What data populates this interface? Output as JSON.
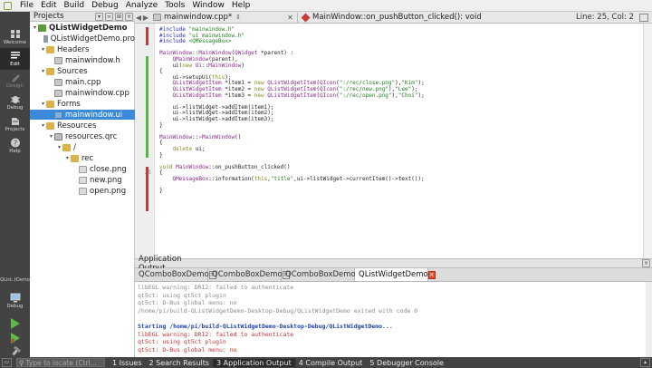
{
  "menu": [
    "File",
    "Edit",
    "Build",
    "Debug",
    "Analyze",
    "Tools",
    "Window",
    "Help"
  ],
  "modes": [
    {
      "label": "Welcome",
      "state": "normal"
    },
    {
      "label": "Edit",
      "state": "active"
    },
    {
      "label": "Design",
      "state": "disabled"
    },
    {
      "label": "Debug",
      "state": "normal"
    },
    {
      "label": "Projects",
      "state": "normal"
    },
    {
      "label": "Help",
      "state": "normal"
    }
  ],
  "kit": {
    "project_label": "QList..tDemo",
    "config_label": "Debug"
  },
  "project_pane": {
    "title": "Projects"
  },
  "tree": [
    {
      "label": "QListWidgetDemo",
      "level": 0,
      "expanded": true,
      "icon": "project-icon",
      "bold": true
    },
    {
      "label": "QListWidgetDemo.pro",
      "level": 1,
      "icon": "pro-file-icon"
    },
    {
      "label": "Headers",
      "level": 1,
      "expanded": true,
      "icon": "folder-icon"
    },
    {
      "label": "mainwindow.h",
      "level": 2,
      "icon": "header-file-icon"
    },
    {
      "label": "Sources",
      "level": 1,
      "expanded": true,
      "icon": "folder-icon"
    },
    {
      "label": "main.cpp",
      "level": 2,
      "icon": "source-file-icon"
    },
    {
      "label": "mainwindow.cpp",
      "level": 2,
      "icon": "source-file-icon"
    },
    {
      "label": "Forms",
      "level": 1,
      "expanded": true,
      "icon": "folder-icon"
    },
    {
      "label": "mainwindow.ui",
      "level": 2,
      "icon": "ui-file-icon",
      "selected": true
    },
    {
      "label": "Resources",
      "level": 1,
      "expanded": true,
      "icon": "folder-icon"
    },
    {
      "label": "resources.qrc",
      "level": 2,
      "expanded": true,
      "icon": "qrc-file-icon"
    },
    {
      "label": "/",
      "level": 3,
      "expanded": true,
      "icon": "folder-icon"
    },
    {
      "label": "rec",
      "level": 4,
      "expanded": true,
      "icon": "folder-icon"
    },
    {
      "label": "close.png",
      "level": 5,
      "icon": "png-file-icon"
    },
    {
      "label": "new.png",
      "level": 5,
      "icon": "png-file-icon"
    },
    {
      "label": "open.png",
      "level": 5,
      "icon": "png-file-icon"
    }
  ],
  "editor": {
    "file_tab": "mainwindow.cpp*",
    "function": "MainWindow::on_pushButton_clicked(): void",
    "position": "Line: 25, Col: 2"
  },
  "code_lines": [
    {
      "n": "",
      "html": "<span class='k-pre'>#include</span> <span class='k-str'>\"mainwindow.h\"</span>"
    },
    {
      "n": "",
      "html": "<span class='k-pre'>#include</span> <span class='k-str'>\"ui_mainwindow.h\"</span>"
    },
    {
      "n": "",
      "html": "<span class='k-pre'>#include</span> <span class='k-str'>&lt;QMessageBox&gt;</span>"
    },
    {
      "n": "",
      "html": ""
    },
    {
      "n": "",
      "html": "<span class='k-type'>MainWindow</span>::<span class='k-type'>MainWindow</span>(<span class='k-type'>QWidget</span> *parent) :"
    },
    {
      "n": "",
      "html": "    <span class='k-type'>QMainWindow</span>(parent),"
    },
    {
      "n": "",
      "html": "    ui(<span class='k-kw'>new</span> <span class='k-type'>Ui</span>::<span class='k-type'>MainWindow</span>)"
    },
    {
      "n": "",
      "html": "{"
    },
    {
      "n": "",
      "html": "    ui-&gt;setupUi(<span class='k-kw'>this</span>);"
    },
    {
      "n": "",
      "html": "    <span class='k-type'>QListWidgetItem</span> *item1 = <span class='k-kw'>new</span> <span class='k-type'>QListWidgetItem</span>(<span class='k-type'>QIcon</span>(<span class='k-str'>\":/rec/close.png\"</span>),<span class='k-str'>\"Kim\"</span>);"
    },
    {
      "n": "",
      "html": "    <span class='k-type'>QListWidgetItem</span> *item2 = <span class='k-kw'>new</span> <span class='k-type'>QListWidgetItem</span>(<span class='k-type'>QIcon</span>(<span class='k-str'>\":/rec/new.png\"</span>),<span class='k-str'>\"Lee\"</span>);"
    },
    {
      "n": "",
      "html": "    <span class='k-type'>QListWidgetItem</span> *item3 = <span class='k-kw'>new</span> <span class='k-type'>QListWidgetItem</span>(<span class='k-type'>QIcon</span>(<span class='k-str'>\":/rec/open.png\"</span>),<span class='k-str'>\"Choi\"</span>);"
    },
    {
      "n": "",
      "html": ""
    },
    {
      "n": "",
      "html": "    ui-&gt;listWidget-&gt;addItem(item1);"
    },
    {
      "n": "",
      "html": "    ui-&gt;listWidget-&gt;addItem(item2);"
    },
    {
      "n": "",
      "html": "    ui-&gt;listWidget-&gt;addItem(item3);"
    },
    {
      "n": "",
      "html": "}"
    },
    {
      "n": "",
      "html": ""
    },
    {
      "n": "",
      "html": "<span class='k-type'>MainWindow</span>::~<span class='k-type'>MainWindow</span>()"
    },
    {
      "n": "",
      "html": "{"
    },
    {
      "n": "",
      "html": "    <span class='k-kw'>delete</span> ui;"
    },
    {
      "n": "",
      "html": "}"
    },
    {
      "n": "",
      "html": ""
    },
    {
      "n": "",
      "html": "<span class='k-kw'>void</span> <span class='k-type'>MainWindow</span>::on_pushButton_clicked()"
    },
    {
      "n": "25",
      "html": "{"
    },
    {
      "n": "",
      "html": "    <span class='k-type'>QMessageBox</span>::information(<span class='k-kw'>this</span>,<span class='k-str'>\"title\"</span>,ui-&gt;listWidget-&gt;currentItem()-&gt;text());"
    },
    {
      "n": "",
      "html": ""
    },
    {
      "n": "",
      "html": "}"
    }
  ],
  "output": {
    "title": "Application Output",
    "tabs": [
      {
        "label": "QComboBoxDemo",
        "active": false
      },
      {
        "label": "QComboBoxDemo",
        "active": false
      },
      {
        "label": "QComboBoxDemo",
        "active": false
      },
      {
        "label": "QListWidgetDemo",
        "active": true
      }
    ],
    "lines": [
      {
        "text": "libEGL warning: DRI2: failed to authenticate",
        "style": "gray"
      },
      {
        "text": "qt5ct: using qt5ct plugin",
        "style": "gray"
      },
      {
        "text": "qt5ct: D-Bus global menu: no",
        "style": "gray"
      },
      {
        "text": "/home/pi/build-QListWidgetDemo-Desktop-Debug/QListWidgetDemo exited with code 0",
        "style": "gray"
      },
      {
        "text": "",
        "style": "gray"
      },
      {
        "text": "Starting /home/pi/build-QListWidgetDemo-Desktop-Debug/QListWidgetDemo...",
        "style": "blue"
      },
      {
        "text": "libEGL warning: DRI2: failed to authenticate",
        "style": "red"
      },
      {
        "text": "qt5ct: using qt5ct plugin",
        "style": "red"
      },
      {
        "text": "qt5ct: D-Bus global menu: no",
        "style": "red"
      }
    ]
  },
  "status": {
    "locator_placeholder": "Type to locate (Ctrl...",
    "panes": [
      {
        "label": "1 Issues",
        "active": false
      },
      {
        "label": "2 Search Results",
        "active": false
      },
      {
        "label": "3 Application Output",
        "active": true
      },
      {
        "label": "4 Compile Output",
        "active": false
      },
      {
        "label": "5 Debugger Console",
        "active": false
      }
    ]
  }
}
